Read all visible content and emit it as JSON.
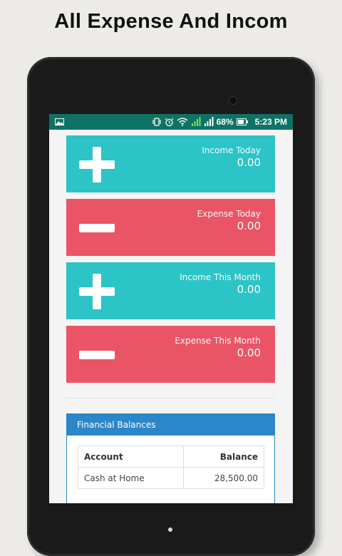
{
  "promo": {
    "title": "All Expense And Incom"
  },
  "status_bar": {
    "battery_percent": "68%",
    "time": "5:23 PM",
    "icons": [
      "image-icon",
      "vibrate-icon",
      "alarm-icon",
      "wifi-icon",
      "signal-icon",
      "signal-icon-2",
      "battery-icon"
    ]
  },
  "cards": [
    {
      "kind": "income",
      "label": "Income Today",
      "value": "0.00",
      "color": "#2cc4c6"
    },
    {
      "kind": "expense",
      "label": "Expense Today",
      "value": "0.00",
      "color": "#e95566"
    },
    {
      "kind": "income",
      "label": "Income This Month",
      "value": "0.00",
      "color": "#2cc4c6"
    },
    {
      "kind": "expense",
      "label": "Expense This Month",
      "value": "0.00",
      "color": "#e95566"
    }
  ],
  "balances": {
    "title": "Financial Balances",
    "columns": [
      "Account",
      "Balance"
    ],
    "rows": [
      {
        "account": "Cash at Home",
        "balance": "28,500.00"
      }
    ]
  },
  "colors": {
    "status_bar": "#0e7264",
    "income": "#2cc4c6",
    "expense": "#e95566",
    "panel_header": "#2b87c9"
  }
}
